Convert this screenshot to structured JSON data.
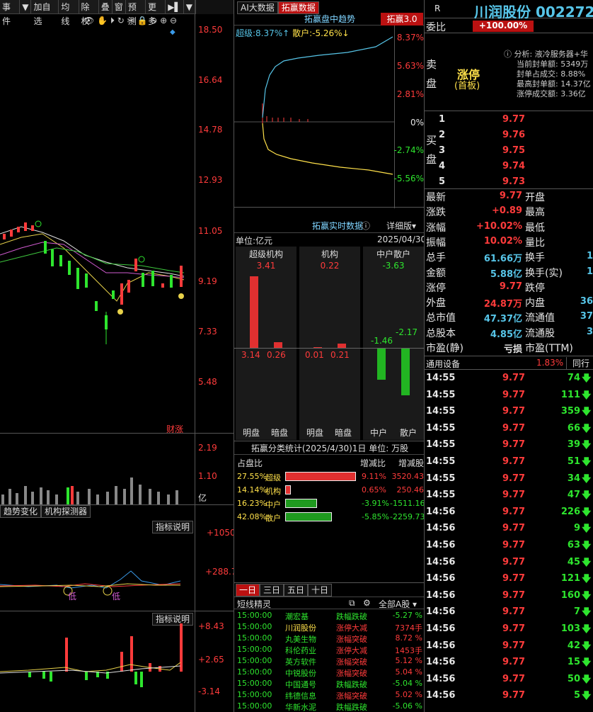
{
  "toolbar": [
    "事件",
    "▼",
    "加自选",
    "均线",
    "除权",
    "叠",
    "窗",
    "预测",
    "更多",
    "▶▌",
    "▼"
  ],
  "left": {
    "price_ticks": [
      "18.50",
      "16.64",
      "14.78",
      "12.93",
      "11.05",
      "9.19",
      "7.33",
      "5.48"
    ],
    "caibao": "财涨",
    "vol_ticks": [
      "2.19",
      "1.10",
      "亿"
    ],
    "tabs": [
      "趋势变化",
      "机构探测器"
    ],
    "indicator_btn": "指标说明",
    "ind1_ticks": [
      "+1050",
      "+288.7"
    ],
    "ind1_marks": [
      "低",
      "低"
    ],
    "ind2_ticks": [
      "+8.43",
      "+2.65",
      "-3.14"
    ]
  },
  "mid": {
    "tabs": [
      "AI大数据",
      "拓赢数据"
    ],
    "trend": {
      "title": "拓赢盘中趋势",
      "badge": "拓赢3.0",
      "super_label": "超级:",
      "super_val": "8.37%↑",
      "retail_label": "散户:",
      "retail_val": "-5.26%↓",
      "ticks": [
        "8.37%",
        "5.63%",
        "2.81%",
        "0%",
        "-2.74%",
        "-5.56%"
      ]
    },
    "realtime": {
      "title": "拓赢实时数据",
      "detail": "详细版",
      "unit": "单位:亿元",
      "date": "2025/04/30",
      "groups": [
        {
          "name": "超级机构",
          "net": "3.41",
          "a": "3.14",
          "b": "0.26"
        },
        {
          "name": "机构",
          "net": "0.22",
          "a": "0.01",
          "b": "0.21"
        },
        {
          "name": "中户散户",
          "net": "-3.63",
          "a": "-1.46",
          "b": "-2.17"
        }
      ],
      "xlabels": [
        "明盘",
        "暗盘",
        "明盘",
        "暗盘",
        "中户",
        "散户"
      ]
    },
    "stats": {
      "title": "拓赢分类统计(2025/4/30)1日  单位: 万股",
      "hdr": [
        "占盘比",
        "增减比",
        "增减股"
      ],
      "rows": [
        {
          "pct": "27.55%",
          "name": "超级",
          "chg": "9.11%",
          "qty": "3520.43",
          "color": "#e03030",
          "w": 100
        },
        {
          "pct": "14.14%",
          "name": "机构",
          "chg": "0.65%",
          "qty": "250.46",
          "color": "#e03030",
          "w": 8
        },
        {
          "pct": "16.23%",
          "name": "中户",
          "chg": "-3.91%",
          "qty": "-1511.16",
          "color": "#1f9a1f",
          "w": 45
        },
        {
          "pct": "42.08%",
          "name": "散户",
          "chg": "-5.85%",
          "qty": "-2259.73",
          "color": "#1f9a1f",
          "w": 66
        }
      ]
    },
    "period_tabs": [
      "一日",
      "三日",
      "五日",
      "十日"
    ],
    "spirit_title": "短线精灵",
    "spirit_filter": "全部A股",
    "spirit": [
      [
        "15:00:00",
        "潮宏基",
        "跌幅跌破",
        "-5.27 %"
      ],
      [
        "15:00:00",
        "川润股份",
        "涨停大减",
        "7374手"
      ],
      [
        "15:00:00",
        "丸美生物",
        "涨幅突破",
        "8.72 %"
      ],
      [
        "15:00:00",
        "科伦药业",
        "涨停大减",
        "1453手"
      ],
      [
        "15:00:00",
        "英方软件",
        "涨幅突破",
        "5.12 %"
      ],
      [
        "15:00:00",
        "中锐股份",
        "涨幅突破",
        "5.04 %"
      ],
      [
        "15:00:00",
        "中国通号",
        "跌幅跌破",
        "-5.04 %"
      ],
      [
        "15:00:00",
        "纬德信息",
        "涨幅突破",
        "5.02 %"
      ],
      [
        "15:00:00",
        "华新水泥",
        "跌幅跌破",
        "-5.06 %"
      ]
    ]
  },
  "right": {
    "r": "R",
    "name": "川润股份 002272",
    "weibi_label": "委比",
    "weibi": "+100.00%",
    "sell_label": [
      "卖",
      "盘"
    ],
    "limit": "涨停",
    "limit_sub": "(首板)",
    "analysis": {
      "title": "分析: 液冷服务器+华",
      "l1": "当前封单额: 5349万",
      "l2": "封单占成交: 8.88%",
      "l3": "最高封单额: 14.37亿",
      "l4": "涨停成交额: 3.36亿"
    },
    "buy_label": [
      "买",
      "盘"
    ],
    "bids": [
      [
        "1",
        "9.77"
      ],
      [
        "2",
        "9.76"
      ],
      [
        "3",
        "9.75"
      ],
      [
        "4",
        "9.74"
      ],
      [
        "5",
        "9.73"
      ]
    ],
    "quote": [
      [
        "最新",
        "9.77",
        "开盘",
        ""
      ],
      [
        "涨跌",
        "+0.89",
        "最高",
        ""
      ],
      [
        "涨幅",
        "+10.02%",
        "最低",
        ""
      ],
      [
        "振幅",
        "10.02%",
        "量比",
        ""
      ],
      [
        "总手",
        "61.66万",
        "换手",
        "1"
      ],
      [
        "金额",
        "5.88亿",
        "换手(实)",
        "1"
      ],
      [
        "涨停",
        "9.77",
        "跌停",
        ""
      ],
      [
        "外盘",
        "24.87万",
        "内盘",
        "36"
      ],
      [
        "总市值",
        "47.37亿",
        "流通值",
        "37"
      ],
      [
        "总股本",
        "4.85亿",
        "流通股",
        "3"
      ],
      [
        "市盈(静)",
        "亏损",
        "市盈(TTM)",
        ""
      ]
    ],
    "sector": "通用设备",
    "sector_pct": "1.83%",
    "peer": "同行",
    "trades": [
      [
        "14:55",
        "9.77",
        "74"
      ],
      [
        "14:55",
        "9.77",
        "111"
      ],
      [
        "14:55",
        "9.77",
        "359"
      ],
      [
        "14:55",
        "9.77",
        "66"
      ],
      [
        "14:55",
        "9.77",
        "39"
      ],
      [
        "14:55",
        "9.77",
        "51"
      ],
      [
        "14:55",
        "9.77",
        "34"
      ],
      [
        "14:55",
        "9.77",
        "47"
      ],
      [
        "14:56",
        "9.77",
        "226"
      ],
      [
        "14:56",
        "9.77",
        "9"
      ],
      [
        "14:56",
        "9.77",
        "63"
      ],
      [
        "14:56",
        "9.77",
        "45"
      ],
      [
        "14:56",
        "9.77",
        "121"
      ],
      [
        "14:56",
        "9.77",
        "160"
      ],
      [
        "14:56",
        "9.77",
        "7"
      ],
      [
        "14:56",
        "9.77",
        "103"
      ],
      [
        "14:56",
        "9.77",
        "42"
      ],
      [
        "14:56",
        "9.77",
        "15"
      ],
      [
        "14:56",
        "9.77",
        "50"
      ],
      [
        "14:56",
        "9.77",
        "5"
      ]
    ]
  }
}
